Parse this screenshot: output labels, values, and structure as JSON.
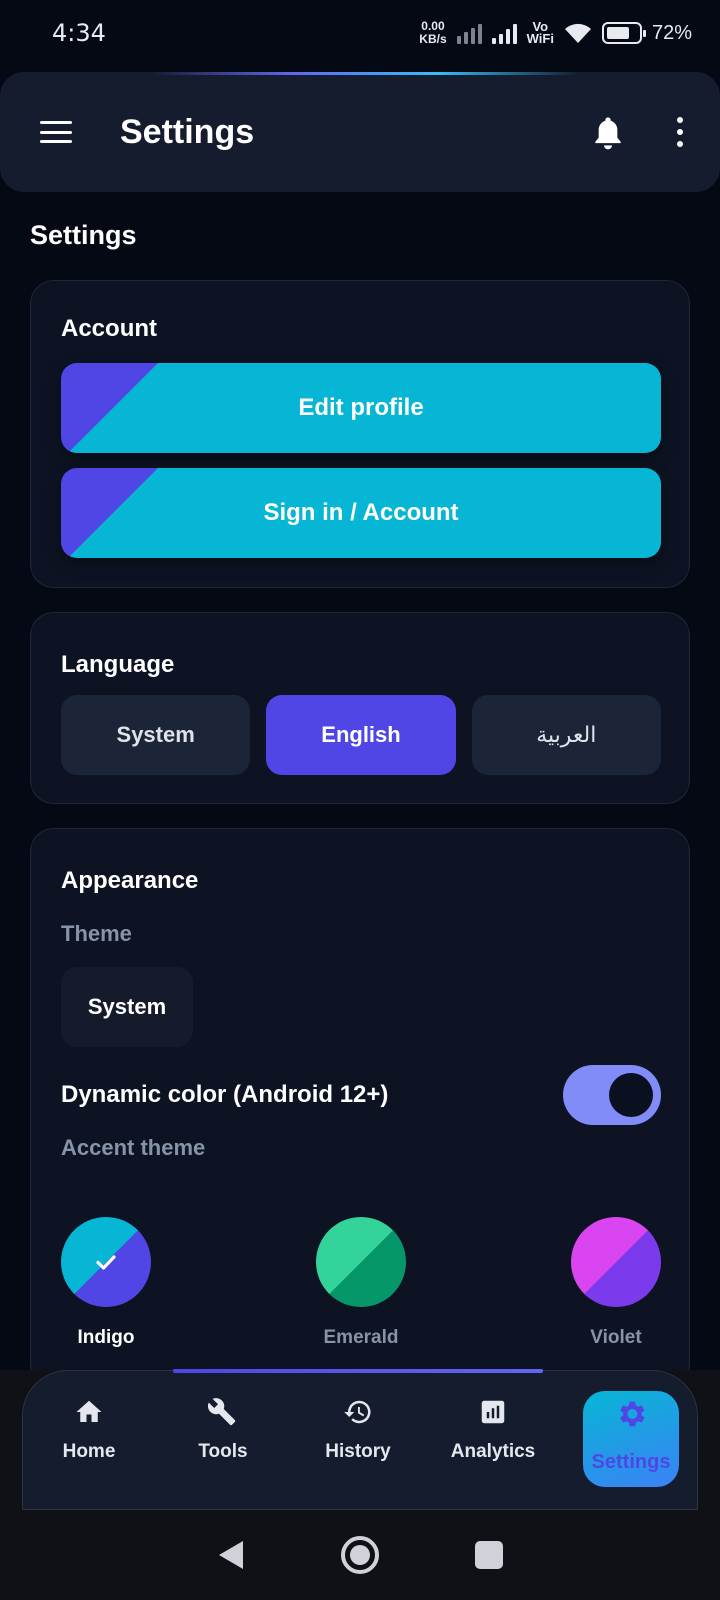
{
  "status_bar": {
    "time": "4:34",
    "net_speed_value": "0.00",
    "net_speed_unit": "KB/s",
    "vowifi_top": "Vo",
    "vowifi_bottom": "WiFi",
    "battery_percent": "72%",
    "battery_level": 0.72
  },
  "app_bar": {
    "title": "Settings",
    "icons": [
      "menu-icon",
      "bell-icon",
      "more-vert-icon"
    ]
  },
  "page": {
    "heading": "Settings"
  },
  "account": {
    "title": "Account",
    "edit_profile": "Edit profile",
    "sign_in": "Sign in / Account"
  },
  "language": {
    "title": "Language",
    "options": [
      "System",
      "English",
      "العربية"
    ],
    "selected": "English"
  },
  "appearance": {
    "title": "Appearance",
    "theme_label": "Theme",
    "theme_value": "System",
    "dynamic_color_label": "Dynamic color (Android 12+)",
    "dynamic_color_on": true,
    "accent_label": "Accent theme",
    "accents": [
      {
        "name": "Indigo",
        "color_a": "#4f46e5",
        "color_b": "#06b6d4",
        "selected": true
      },
      {
        "name": "Emerald",
        "color_a": "#059669",
        "color_b": "#34d399",
        "selected": false
      },
      {
        "name": "Violet",
        "color_a": "#7c3aed",
        "color_b": "#d946ef",
        "selected": false
      }
    ]
  },
  "bottom_nav": {
    "items": [
      {
        "label": "Home",
        "icon": "home-icon"
      },
      {
        "label": "Tools",
        "icon": "wrench-icon"
      },
      {
        "label": "History",
        "icon": "history-icon"
      },
      {
        "label": "Analytics",
        "icon": "analytics-icon"
      },
      {
        "label": "Settings",
        "icon": "gear-icon"
      }
    ],
    "active": "Settings"
  },
  "colors": {
    "background": "#050914",
    "card": "#0d1322",
    "primary": "#4f46e5",
    "accent": "#06b6d4",
    "toggle": "#818cf8"
  }
}
